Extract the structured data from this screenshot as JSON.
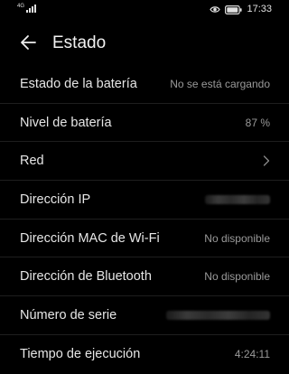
{
  "status_bar": {
    "network_label": "4G",
    "time": "17:33",
    "icons": [
      "signal-icon",
      "eye-icon",
      "battery-icon"
    ]
  },
  "header": {
    "back_icon": "arrow-left-icon",
    "title": "Estado"
  },
  "items": [
    {
      "label": "Estado de la batería",
      "value": "No se está cargando"
    },
    {
      "label": "Nivel de batería",
      "value": "87 %"
    },
    {
      "label": "Red",
      "value": "",
      "chevron": true
    },
    {
      "label": "Dirección IP",
      "value": "",
      "redacted": true
    },
    {
      "label": "Dirección MAC de Wi-Fi",
      "value": "No disponible"
    },
    {
      "label": "Dirección de Bluetooth",
      "value": "No disponible"
    },
    {
      "label": "Número de serie",
      "value": "",
      "redacted": true
    },
    {
      "label": "Tiempo de ejecución",
      "value": "4:24:11"
    }
  ],
  "colors": {
    "background": "#000000",
    "label": "#e6e6e6",
    "value": "#9a9a9a"
  }
}
